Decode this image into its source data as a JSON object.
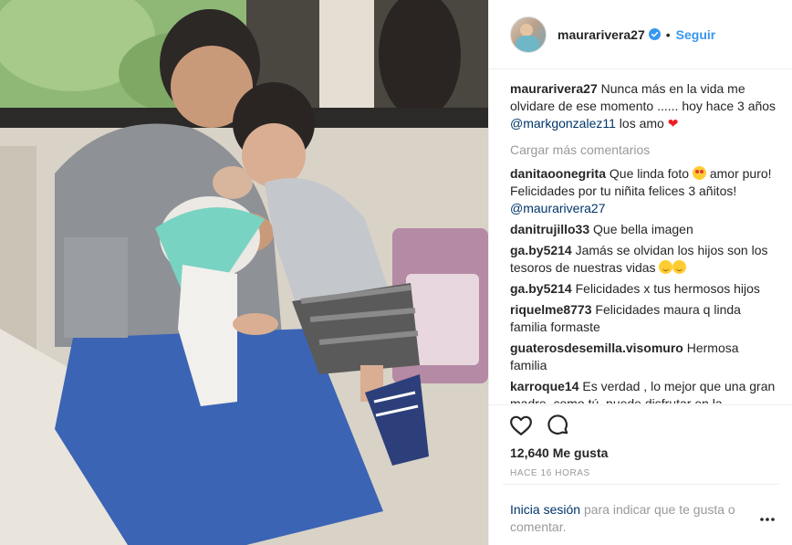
{
  "post": {
    "author": {
      "username": "maurarivera27",
      "verified": true,
      "separator": "•",
      "follow_label": "Seguir"
    },
    "caption": {
      "user": "maurarivera27",
      "text": "Nunca más en la vida me olvidare de ese momento ...... hoy hace 3 años",
      "mention": "@markgonzalez11",
      "text_after": "los amo",
      "emoji": "❤"
    },
    "load_more_label": "Cargar más comentarios",
    "comments": [
      {
        "user": "danitaoonegrita",
        "text_before": "Que linda foto",
        "text": "amor puro! Felicidades por tu niñita felices 3 añitos!",
        "mention": "@maurarivera27"
      },
      {
        "user": "danitrujillo33",
        "text": "Que bella imagen"
      },
      {
        "user": "ga.by5214",
        "text": "Jamás se olvidan los hijos son los tesoros de nuestras vidas"
      },
      {
        "user": "ga.by5214",
        "text": "Felicidades x tus hermosos hijos"
      },
      {
        "user": "riquelme8773",
        "text": "Felicidades maura q linda familia formaste"
      },
      {
        "user": "guaterosdesemilla.visomuro",
        "text": "Hermosa familia"
      },
      {
        "user": "karroque14",
        "text": "Es verdad , lo mejor que una gran madre, como tú, puede disfrutar en la"
      }
    ],
    "likes_label": "12,640 Me gusta",
    "timestamp": "HACE 16 HORAS",
    "login": {
      "link_label": "Inicia sesión",
      "text": "para indicar que te gusta o comentar."
    },
    "icons": {
      "like": "heart-outline-icon",
      "comment": "comment-bubble-icon",
      "more": "more-options-icon",
      "verified": "verified-badge-icon"
    },
    "colors": {
      "link_blue": "#3897f0",
      "mention_dark_blue": "#003569",
      "muted_gray": "#999999",
      "border": "#efefef",
      "heart_red": "#ed1d24"
    }
  }
}
